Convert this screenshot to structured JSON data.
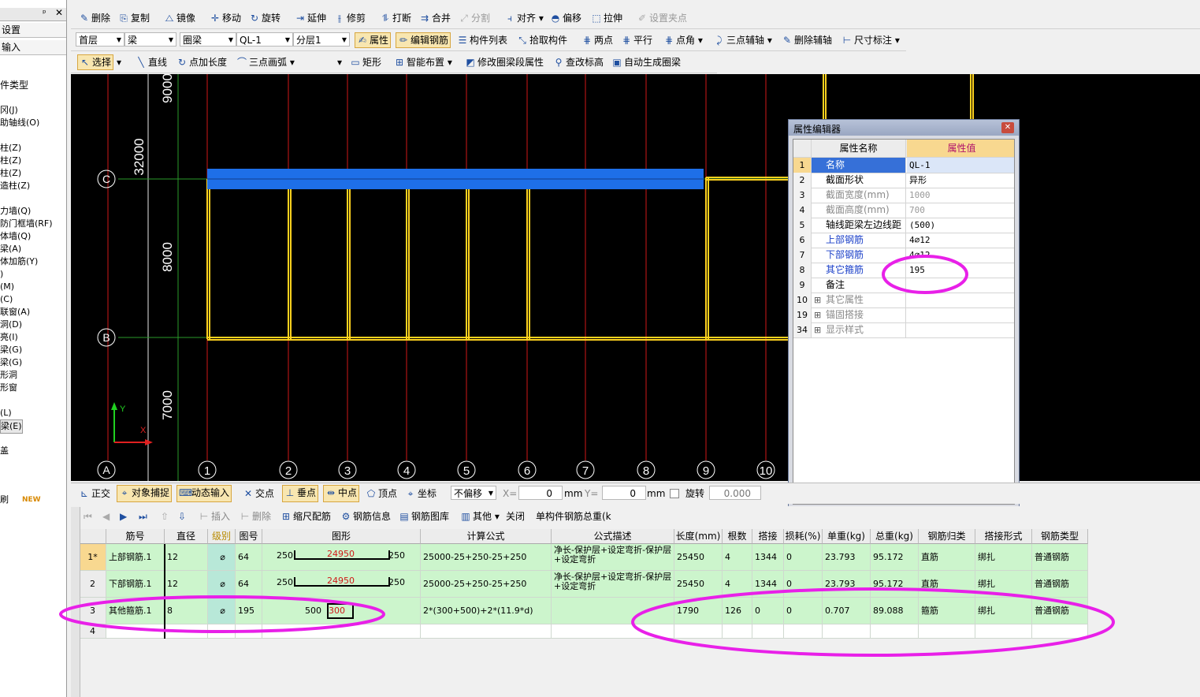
{
  "left_panel": {
    "buttons": [
      "设置",
      "输入"
    ],
    "items": [
      "件类型",
      "冈(J)",
      "助轴线(O)",
      "柱(Z)",
      "柱(Z)",
      "柱(Z)",
      "造柱(Z)",
      "力墙(Q)",
      "防门框墙(RF)",
      "体墙(Q)",
      "梁(A)",
      "体加筋(Y)",
      ")",
      "(M)",
      "(C)",
      "联窗(A)",
      "洞(D)",
      "亮(I)",
      "梁(G)",
      "梁(G)",
      "形洞",
      "形窗",
      "(L)",
      "梁(E)",
      "盖",
      "刷",
      "NEW"
    ]
  },
  "toolbar1": [
    "删除",
    "复制",
    "镜像",
    "移动",
    "旋转",
    "延伸",
    "修剪",
    "打断",
    "合并",
    "分割",
    "对齐",
    "偏移",
    "拉伸",
    "设置夹点"
  ],
  "toolbar2": {
    "combos": [
      "首层",
      "梁",
      "圈梁",
      "QL-1",
      "分层1"
    ],
    "buttons": [
      "属性",
      "编辑钢筋",
      "构件列表",
      "拾取构件",
      "两点",
      "平行",
      "点角",
      "三点辅轴",
      "删除辅轴",
      "尺寸标注"
    ]
  },
  "toolbar3": [
    "选择",
    "直线",
    "点加长度",
    "三点画弧",
    "矩形",
    "智能布置",
    "修改圈梁段属性",
    "查改标高",
    "自动生成圈梁"
  ],
  "canvas": {
    "row_labels": [
      "C",
      "B",
      "A"
    ],
    "col_labels": [
      "1",
      "2",
      "3",
      "4",
      "5",
      "6",
      "7",
      "8",
      "9",
      "10"
    ],
    "dims": [
      "9000",
      "32000",
      "8000",
      "7000"
    ],
    "axis_y": "Y",
    "axis_x": "X"
  },
  "prop_editor": {
    "title": "属性编辑器",
    "head_name": "属性名称",
    "head_value": "属性值",
    "rows": [
      {
        "n": "1",
        "k": "名称",
        "v": "QL-1"
      },
      {
        "n": "2",
        "k": "截面形状",
        "v": "异形"
      },
      {
        "n": "3",
        "k": "截面宽度(mm)",
        "v": "1000"
      },
      {
        "n": "4",
        "k": "截面高度(mm)",
        "v": "700"
      },
      {
        "n": "5",
        "k": "轴线距梁左边线距",
        "v": "(500)"
      },
      {
        "n": "6",
        "k": "上部钢筋",
        "v": "4⌀12"
      },
      {
        "n": "7",
        "k": "下部钢筋",
        "v": "4⌀12"
      },
      {
        "n": "8",
        "k": "其它箍筋",
        "v": "195"
      },
      {
        "n": "9",
        "k": "备注",
        "v": ""
      },
      {
        "n": "10",
        "k": "其它属性",
        "v": ""
      },
      {
        "n": "19",
        "k": "锚固搭接",
        "v": ""
      },
      {
        "n": "34",
        "k": "显示样式",
        "v": ""
      }
    ]
  },
  "status": {
    "buttons": [
      "正交",
      "对象捕捉",
      "动态输入",
      "交点",
      "垂点",
      "中点",
      "顶点",
      "坐标"
    ],
    "offset": "不偏移",
    "x_label": "X=",
    "x_value": "0",
    "y_label": "Y=",
    "y_value": "0",
    "unit": "mm",
    "rotate_label": "旋转",
    "rotate_value": "0.000"
  },
  "rebar_toolbar": [
    "插入",
    "删除",
    "缩尺配筋",
    "钢筋信息",
    "钢筋图库",
    "其他",
    "关闭",
    "单构件钢筋总重(k"
  ],
  "rebar_table": {
    "headers": [
      "筋号",
      "直径(mm)",
      "级别",
      "图号",
      "图形",
      "计算公式",
      "公式描述",
      "长度(mm)",
      "根数",
      "搭接",
      "损耗(%)",
      "单重(kg)",
      "总重(kg)",
      "钢筋归类",
      "搭接形式",
      "钢筋类型"
    ],
    "rows": [
      {
        "idx": "1*",
        "name": "上部钢筋.1",
        "dia": "12",
        "grade": "⌀",
        "fig": "64",
        "left": "250",
        "mid": "24950",
        "right": "250",
        "formula": "25000-25+250-25+250",
        "desc": "净长-保护层+设定弯折-保护层+设定弯折",
        "len": "25450",
        "count": "4",
        "lap": "1344",
        "loss": "0",
        "unit_w": "23.793",
        "total_w": "95.172",
        "cat": "直筋",
        "lap_type": "绑扎",
        "type": "普通钢筋"
      },
      {
        "idx": "2",
        "name": "下部钢筋.1",
        "dia": "12",
        "grade": "⌀",
        "fig": "64",
        "left": "250",
        "mid": "24950",
        "right": "250",
        "formula": "25000-25+250-25+250",
        "desc": "净长-保护层+设定弯折-保护层+设定弯折",
        "len": "25450",
        "count": "4",
        "lap": "1344",
        "loss": "0",
        "unit_w": "23.793",
        "total_w": "95.172",
        "cat": "直筋",
        "lap_type": "绑扎",
        "type": "普通钢筋"
      },
      {
        "idx": "3",
        "name": "其他箍筋.1",
        "dia": "8",
        "grade": "⌀",
        "fig": "195",
        "left": "500",
        "mid": "300",
        "right": "",
        "formula": "2*(300+500)+2*(11.9*d)",
        "desc": "",
        "len": "1790",
        "count": "126",
        "lap": "0",
        "loss": "0",
        "unit_w": "0.707",
        "total_w": "89.088",
        "cat": "箍筋",
        "lap_type": "绑扎",
        "type": "普通钢筋"
      },
      {
        "idx": "4",
        "name": "",
        "dia": "",
        "grade": "",
        "fig": "",
        "left": "",
        "mid": "",
        "right": "",
        "formula": "",
        "desc": "",
        "len": "",
        "count": "",
        "lap": "",
        "loss": "",
        "unit_w": "",
        "total_w": "",
        "cat": "",
        "lap_type": "",
        "type": ""
      }
    ]
  },
  "colors": {
    "beam": "#ffd21e",
    "highlight": "#1e6fe8",
    "grid": "#d01818",
    "annotation": "#e820e8"
  }
}
